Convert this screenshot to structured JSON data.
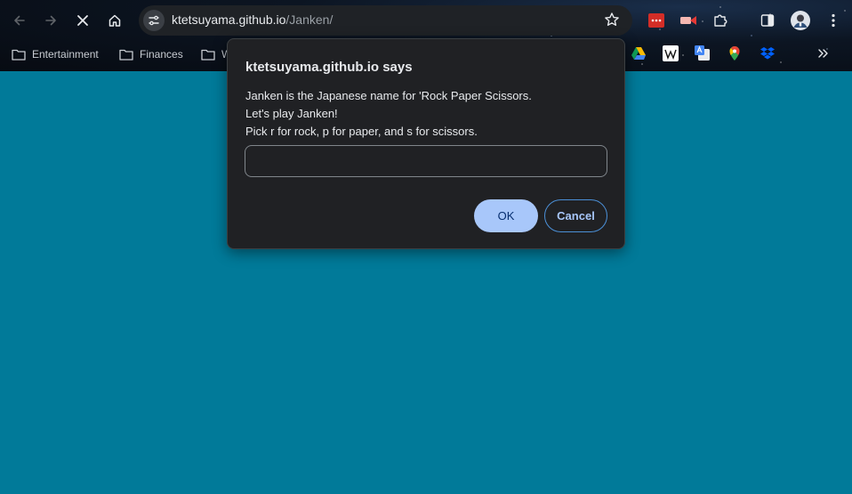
{
  "browser": {
    "url_host": "ktetsuyama.github.io",
    "url_path": "/Janken/",
    "loading": true
  },
  "bookmarks": [
    {
      "label": "Entertainment",
      "icon": "folder-icon"
    },
    {
      "label": "Finances",
      "icon": "folder-icon"
    },
    {
      "label": "W",
      "icon": "folder-icon"
    }
  ],
  "bookmark_shortcuts": [
    "google-drive-icon",
    "wikipedia-icon",
    "google-translate-icon",
    "google-maps-icon",
    "dropbox-icon"
  ],
  "extensions": [
    "lastpass-icon",
    "cast-icon",
    "puzzle-icon",
    "side-panel-icon",
    "profile-avatar",
    "menu-icon"
  ],
  "dialog": {
    "title": "ktetsuyama.github.io says",
    "lines": [
      "Janken is the Japanese name for 'Rock Paper Scissors.",
      "Let's play Janken!",
      "Pick r for rock, p for paper, and s for scissors."
    ],
    "input_value": "",
    "ok_label": "OK",
    "cancel_label": "Cancel"
  },
  "colors": {
    "page_background": "#017a99",
    "dialog_background": "#202124",
    "ok_button": "#a8c7fa",
    "text": "#e8eaed"
  }
}
